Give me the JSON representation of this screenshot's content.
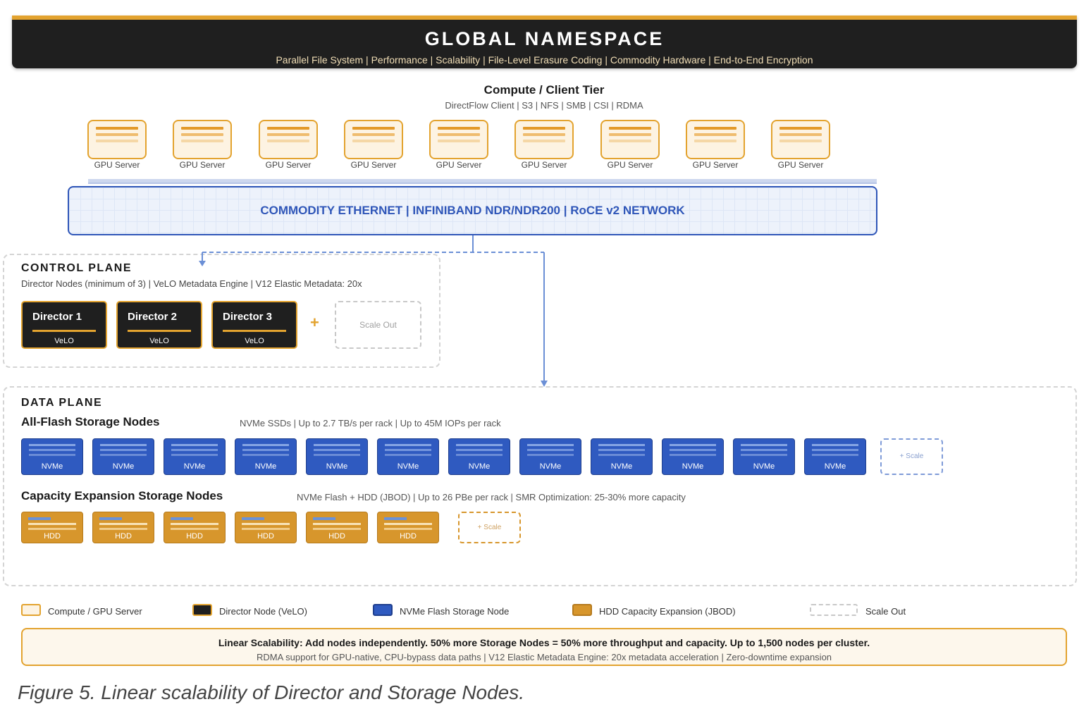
{
  "header": {
    "title": "GLOBAL NAMESPACE",
    "subtitle": "Parallel File System | Performance | Scalability | File-Level Erasure Coding | Commodity Hardware | End-to-End Encryption"
  },
  "compute_tier": {
    "title": "Compute / Client Tier",
    "subtitle": "DirectFlow Client | S3 | NFS | SMB | CSI | RDMA",
    "servers": [
      "GPU Server",
      "GPU Server",
      "GPU Server",
      "GPU Server",
      "GPU Server",
      "GPU Server",
      "GPU Server",
      "GPU Server",
      "GPU Server"
    ]
  },
  "network": {
    "label": "COMMODITY ETHERNET | INFINIBAND NDR/NDR200 | RoCE v2 NETWORK"
  },
  "control_plane": {
    "title": "CONTROL PLANE",
    "subtitle": "Director Nodes (minimum of 3) | VeLO Metadata Engine | V12 Elastic Metadata: 20x",
    "directors": [
      {
        "name": "Director 1",
        "engine": "VeLO"
      },
      {
        "name": "Director 2",
        "engine": "VeLO"
      },
      {
        "name": "Director 3",
        "engine": "VeLO"
      }
    ],
    "plus": "+",
    "scale_out": "Scale Out"
  },
  "data_plane": {
    "title": "DATA PLANE",
    "flash": {
      "title": "All-Flash Storage Nodes",
      "subtitle": "NVMe SSDs | Up to 2.7 TB/s per rack | Up to 45M IOPs per rack",
      "nodes": [
        "NVMe",
        "NVMe",
        "NVMe",
        "NVMe",
        "NVMe",
        "NVMe",
        "NVMe",
        "NVMe",
        "NVMe",
        "NVMe",
        "NVMe",
        "NVMe"
      ],
      "scale": "+ Scale"
    },
    "capacity": {
      "title": "Capacity Expansion Storage Nodes",
      "subtitle": "NVMe Flash + HDD (JBOD) | Up to 26 PBe per rack | SMR Optimization: 25-30% more capacity",
      "nodes": [
        "HDD",
        "HDD",
        "HDD",
        "HDD",
        "HDD",
        "HDD"
      ],
      "scale": "+ Scale"
    }
  },
  "legend": [
    {
      "label": "Compute / GPU Server",
      "color": "#fdf3e2",
      "border": "#e3a32f"
    },
    {
      "label": "Director Node (VeLO)",
      "color": "#1f1f1f",
      "border": "#e3a32f"
    },
    {
      "label": "NVMe Flash Storage Node",
      "color": "#2f5ac0",
      "border": "#1f3f8e"
    },
    {
      "label": "HDD Capacity Expansion (JBOD)",
      "color": "#d7962c",
      "border": "#b57a1d"
    },
    {
      "label": "Scale Out",
      "color": "#ffffff",
      "border": "#c8c8c8"
    }
  ],
  "footer": {
    "main": "Linear Scalability: Add nodes independently. 50% more Storage Nodes = 50% more throughput and capacity. Up to 1,500 nodes per cluster.",
    "sub": "RDMA support for GPU-native, CPU-bypass data paths | V12 Elastic Metadata Engine: 20x metadata acceleration | Zero-downtime expansion"
  },
  "caption": "Figure 5. Linear scalability of Director and Storage Nodes.",
  "colors": {
    "accent_orange": "#e3a32f",
    "network_blue": "#2f56b8",
    "nvme_blue": "#2f5ac0",
    "hdd_orange": "#d7962c",
    "header_dark": "#1f1f1f"
  }
}
